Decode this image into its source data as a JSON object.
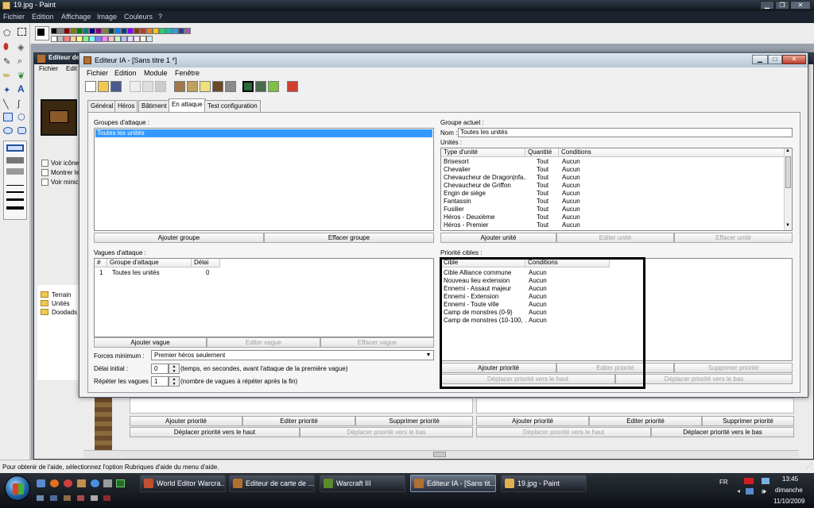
{
  "paint": {
    "title": "19.jpg - Paint",
    "menu": [
      "Fichier",
      "Edition",
      "Affichage",
      "Image",
      "Couleurs",
      "?"
    ],
    "status": "Pour obtenir de l'aide, sélectionnez l'option Rubriques d'aide du menu d'aide.",
    "palette_top": [
      "#000000",
      "#808080",
      "#800000",
      "#808000",
      "#008000",
      "#008080",
      "#000080",
      "#800080",
      "#808040",
      "#004040",
      "#0080ff",
      "#004080",
      "#8000ff",
      "#804000",
      "#c0392b",
      "#e67e22",
      "#f1c40f",
      "#2ecc71",
      "#1abc9c",
      "#3498db",
      "#2c3e8f",
      "#9b59b6"
    ],
    "palette_bottom": [
      "#ffffff",
      "#c0c0c0",
      "#ff8080",
      "#ffd0a0",
      "#ffff80",
      "#80ff80",
      "#80ffff",
      "#8080ff",
      "#ff80ff",
      "#ffc0c0",
      "#c0ffc0",
      "#c0c0ff",
      "#e0e0ff",
      "#ffe0ff",
      "#f5f5dc",
      "#d0e8ff"
    ]
  },
  "bg_editor": {
    "title": "Editeur de",
    "menu": [
      "Fichier",
      "Edit"
    ],
    "checks": [
      "Voir icône",
      "Montrer le",
      "Voir minic"
    ],
    "tree": [
      "Terrain",
      "Unités",
      "Doodads"
    ],
    "row1": [
      "Ajouter priorité",
      "Editer priorité",
      "Supprimer priorité",
      "Ajouter priorité",
      "Editer priorité",
      "Supprimer priorité"
    ],
    "row2": [
      "Déplacer priorité vers le haut",
      "Déplacer priorité vers le bas",
      "Déplacer priorité vers le haut",
      "Déplacer priorité vers le bas"
    ]
  },
  "window": {
    "title": "Editeur IA - [Sans titre 1 *]",
    "menu": [
      "Fichier",
      "Edition",
      "Module",
      "Fenêtre"
    ],
    "tabs": [
      "Général",
      "Héros",
      "Bâtiment",
      "En attaque",
      "Test configuration"
    ],
    "active_tab": "En attaque"
  },
  "groups": {
    "label": "Groupes d'attaque :",
    "items": [
      "Toutes les unités"
    ],
    "add": "Ajouter groupe",
    "delete": "Effacer groupe"
  },
  "current_group": {
    "label": "Groupe actuel :",
    "name_label": "Nom :",
    "name_value": "Toutes les unités",
    "units_label": "Unités :",
    "headers": [
      "Type d'unité",
      "Quantité",
      "Conditions"
    ],
    "rows": [
      [
        "Brisesort",
        "Tout",
        "Aucun"
      ],
      [
        "Chevalier",
        "Tout",
        "Aucun"
      ],
      [
        "Chevaucheur de Dragon|nfa...",
        "Tout",
        "Aucun"
      ],
      [
        "Chevaucheur de Griffon",
        "Tout",
        "Aucun"
      ],
      [
        "Engin de siège",
        "Tout",
        "Aucun"
      ],
      [
        "Fantassin",
        "Tout",
        "Aucun"
      ],
      [
        "Fusilier",
        "Tout",
        "Aucun"
      ],
      [
        "Héros - Deuxième",
        "Tout",
        "Aucun"
      ],
      [
        "Héros - Premier",
        "Tout",
        "Aucun"
      ]
    ],
    "add": "Ajouter unité",
    "edit": "Editer unité",
    "delete": "Effacer unité"
  },
  "waves": {
    "label": "Vagues d'attaque :",
    "headers": [
      "#",
      "Groupe d'attaque",
      "Délai"
    ],
    "rows": [
      [
        "1",
        "Toutes les unités",
        "0"
      ]
    ],
    "add": "Ajouter vague",
    "edit": "Editer vague",
    "delete": "Effacer vague",
    "min_forces_label": "Forces minimum :",
    "min_forces_value": "Premier héros seulement",
    "initial_delay_label": "Délai initial :",
    "initial_delay_value": "0",
    "initial_delay_hint": "(temps, en secondes, avant l'attaque de la première vague)",
    "repeat_label": "Répéter les vagues :",
    "repeat_value": "1",
    "repeat_hint": "(nombre de vagues à répéter après la fin)"
  },
  "targets": {
    "label": "Priorité cibles :",
    "headers": [
      "Cible",
      "Conditions"
    ],
    "rows": [
      [
        "Cible Alliance commune",
        "Aucun"
      ],
      [
        "Nouveau lieu extension",
        "Aucun"
      ],
      [
        "Ennemi - Assaut majeur",
        "Aucun"
      ],
      [
        "Ennemi - Extension",
        "Aucun"
      ],
      [
        "Ennemi - Toute ville",
        "Aucun"
      ],
      [
        "Camp de monstres (0-9)",
        "Aucun"
      ],
      [
        "Camp de monstres (10-100, ...",
        "Aucun"
      ]
    ],
    "add": "Ajouter priorité",
    "edit": "Editer priorité",
    "delete": "Supprimer priorité",
    "up": "Déplacer priorité vers le haut",
    "down": "Déplacer priorité vers le bas"
  },
  "taskbar": {
    "buttons": [
      "World Editor Warcra...",
      "Editeur de carte de ...",
      "Warcraft III",
      "Editeur IA - [Sans tit...",
      "19.jpg - Paint"
    ],
    "active": 3,
    "lang": "FR",
    "time": "13:45",
    "day": "dimanche",
    "date": "11/10/2009"
  }
}
